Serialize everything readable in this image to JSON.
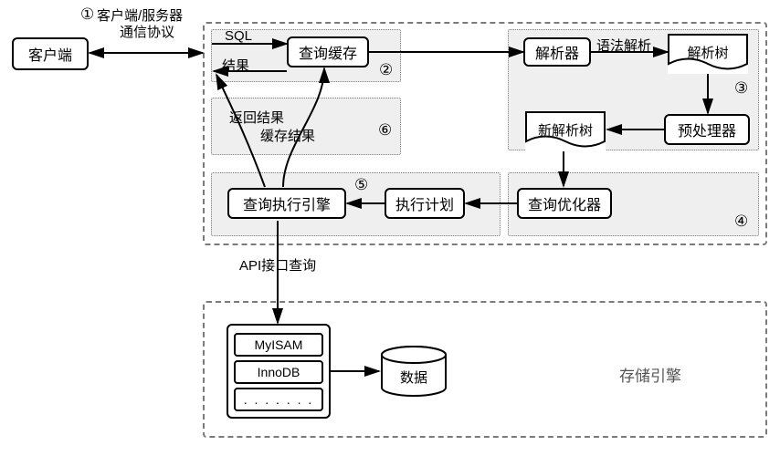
{
  "nodes": {
    "client": "客户端",
    "query_cache": "查询缓存",
    "parser": "解析器",
    "parse_tree": "解析树",
    "preprocessor": "预处理器",
    "new_parse_tree": "新解析树",
    "query_optimizer": "查询优化器",
    "exec_plan": "执行计划",
    "exec_engine": "查询执行引擎",
    "storage_engines_title": "存储引擎",
    "data": "数据",
    "engines": {
      "myisam": "MyISAM",
      "innodb": "InnoDB",
      "more": ". . . . . . ."
    }
  },
  "edges": {
    "protocol_line1": "客户端/服务器",
    "protocol_line2": "通信协议",
    "sql": "SQL",
    "result": "结果",
    "grammar_parse": "语法解析",
    "return_result": "返回结果",
    "cache_result": "缓存结果",
    "api_query": "API接口查询"
  },
  "markers": {
    "s1": "①",
    "s2": "②",
    "s3": "③",
    "s4": "④",
    "s5": "⑤",
    "s6": "⑥"
  }
}
